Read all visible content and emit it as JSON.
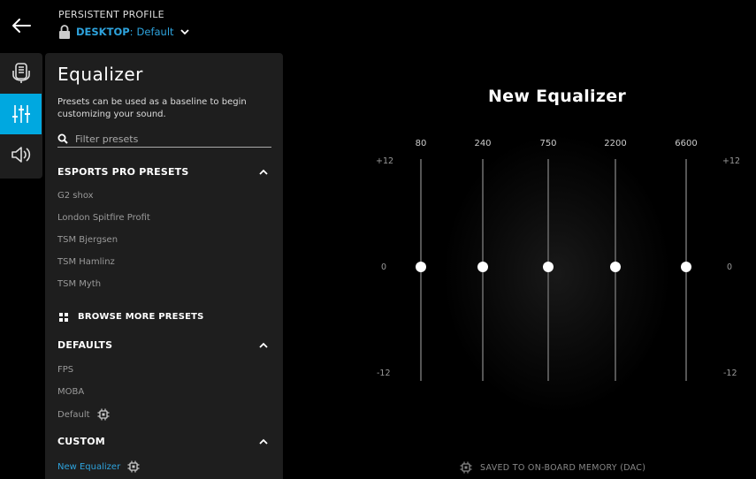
{
  "header": {
    "profile_label": "PERSISTENT PROFILE",
    "device": "DESKTOP",
    "colon": ":",
    "profile_name": "Default"
  },
  "sidebar": {
    "items": [
      {
        "icon": "headset-device-icon",
        "active": false
      },
      {
        "icon": "equalizer-icon",
        "active": true
      },
      {
        "icon": "speaker-sound-icon",
        "active": false
      }
    ]
  },
  "panel": {
    "title": "Equalizer",
    "description": "Presets can be used as a baseline to begin customizing your sound.",
    "search_placeholder": "Filter presets",
    "esports_header": "ESPORTS PRO PRESETS",
    "esports_items": [
      "G2 shox",
      "London Spitfire Profit",
      "TSM Bjergsen",
      "TSM Hamlinz",
      "TSM Myth"
    ],
    "browse_label": "BROWSE MORE PRESETS",
    "defaults_header": "DEFAULTS",
    "defaults_items": [
      "FPS",
      "MOBA",
      "Default"
    ],
    "custom_header": "CUSTOM",
    "custom_items": [
      "New Equalizer"
    ]
  },
  "equalizer": {
    "title": "New Equalizer",
    "bands": [
      {
        "freq": "80",
        "gain": 0
      },
      {
        "freq": "240",
        "gain": 0
      },
      {
        "freq": "750",
        "gain": 0
      },
      {
        "freq": "2200",
        "gain": 0
      },
      {
        "freq": "6600",
        "gain": 0
      }
    ],
    "scale_max": "+12",
    "scale_mid": "0",
    "scale_min": "-12",
    "saved_text": "SAVED TO ON-BOARD MEMORY (DAC)"
  },
  "colors": {
    "accent": "#00a8e0",
    "panel": "#1e1e1e",
    "background": "#000000"
  }
}
